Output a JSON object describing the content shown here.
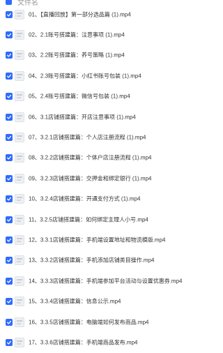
{
  "header": {
    "title": "文件名"
  },
  "files": [
    "01、【直播回放】第一部分选品篇 (1).mp4",
    "02、2.1账号搭建篇：注意事项 (1).mp4",
    "03、2.2账号搭建篇：养号策略 (1).mp4",
    "04、2.3账号搭建篇：小红书账号包装 (1).mp4",
    "05、2.4账号搭建篇：微信号包装 (1).mp4",
    "06、3.1店铺搭建篇：开店注意事项 (1).mp4",
    "07、3.2.1店铺搭建篇：个人店注册流程 (1).mp4",
    "08、3.2.2店铺搭建篇：个体户店注册流程 (1).mp4",
    "09、3.2.3店铺搭建篇：交押金和绑定银行 (1).mp4",
    "10、3.2.4店铺搭建篇：开通支付方式 (1).mp4",
    "11、3.2.5店铺搭建篇：如何绑定主理人小号.mp4",
    "12、3.3.1店铺搭建篇：手机端设置地址和物流模版.mp4",
    "13、3.3.2店铺搭建篇：手机添加店铺类目操作.mp4",
    "14、3.3.3店铺搭建篇：手机端参加平台活动与设置优惠券.mp4",
    "15、3.3.4店铺搭建篇：信息公示.mp4",
    "16、3.3.5店铺搭建篇：电脑端如何发布商品.mp4",
    "17、3.3.6店铺搭建篇：手机端商品发布.mp4"
  ],
  "colors": {
    "checkbox": "#2f6bff",
    "text": "#333333",
    "header_text": "#999999"
  },
  "icons": {
    "checkbox": "checkbox-checked-icon",
    "thumbnail": "video-thumbnail-icon"
  }
}
